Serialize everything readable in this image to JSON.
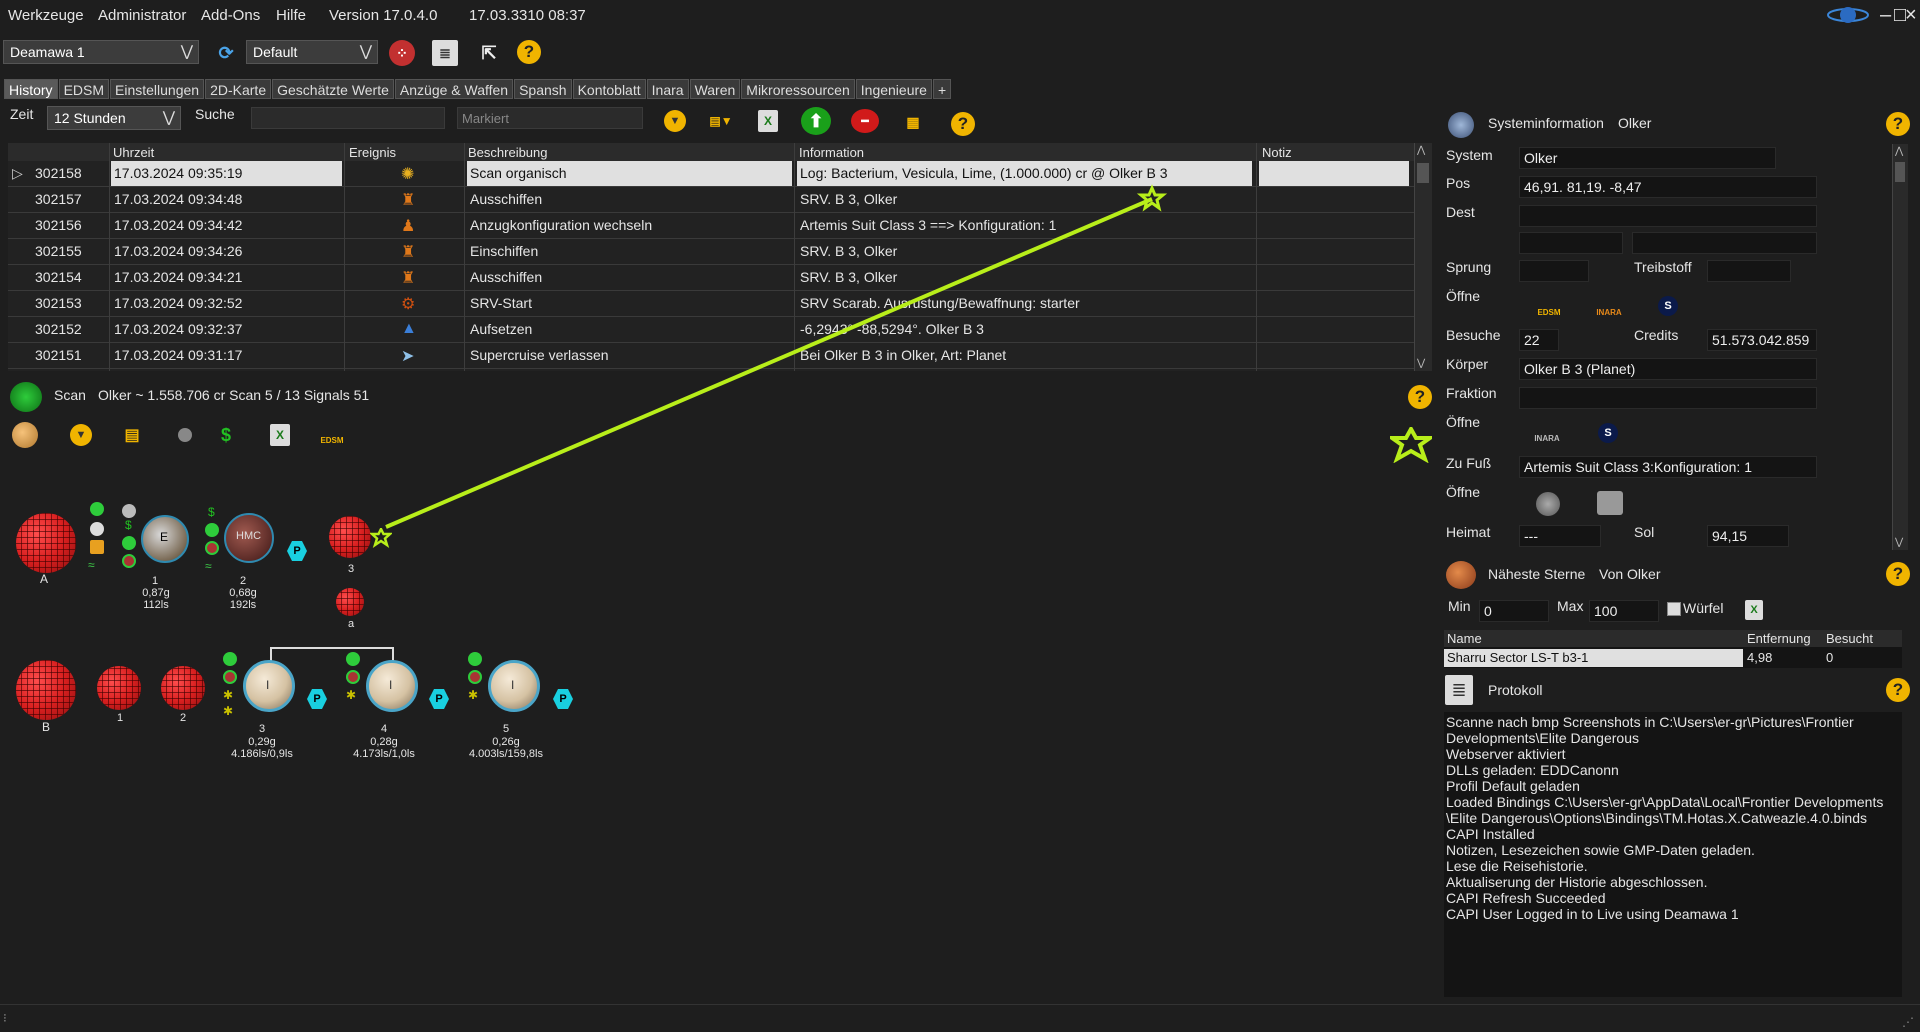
{
  "menu": {
    "items": [
      "Werkzeuge",
      "Administrator",
      "Add-Ons",
      "Hilfe"
    ],
    "version": "Version 17.0.4.0",
    "datetime": "17.03.3310 08:37"
  },
  "toolbar": {
    "commander": "Deamawa 1",
    "profile": "Default"
  },
  "tabs": [
    "History",
    "EDSM",
    "Einstellungen",
    "2D-Karte",
    "Geschätzte Werte",
    "Anzüge & Waffen",
    "Spansh",
    "Kontoblatt",
    "Inara",
    "Waren",
    "Mikroressourcen",
    "Ingenieure",
    "+"
  ],
  "filter": {
    "zeit_label": "Zeit",
    "zeit_value": "12 Stunden",
    "suche_label": "Suche",
    "suche_value": "",
    "markiert_placeholder": "Markiert"
  },
  "grid": {
    "columns": [
      "Uhrzeit",
      "Ereignis",
      "Beschreibung",
      "Information",
      "Notiz"
    ],
    "rows": [
      {
        "id": "302158",
        "time": "17.03.2024 09:35:19",
        "desc": "Scan organisch",
        "info": "Log: Bacterium, Vesicula, Lime, (1.000.000) cr @ Olker B 3",
        "note": ""
      },
      {
        "id": "302157",
        "time": "17.03.2024 09:34:48",
        "desc": "Ausschiffen",
        "info": "SRV. B 3, Olker",
        "note": ""
      },
      {
        "id": "302156",
        "time": "17.03.2024 09:34:42",
        "desc": "Anzugkonfiguration wechseln",
        "info": "Artemis Suit Class 3 ==> Konfiguration: 1",
        "note": ""
      },
      {
        "id": "302155",
        "time": "17.03.2024 09:34:26",
        "desc": "Einschiffen",
        "info": "SRV. B 3, Olker",
        "note": ""
      },
      {
        "id": "302154",
        "time": "17.03.2024 09:34:21",
        "desc": "Ausschiffen",
        "info": "SRV. B 3, Olker",
        "note": ""
      },
      {
        "id": "302153",
        "time": "17.03.2024 09:32:52",
        "desc": "SRV-Start",
        "info": "SRV Scarab. Ausrüstung/Bewaffnung: starter",
        "note": ""
      },
      {
        "id": "302152",
        "time": "17.03.2024 09:32:37",
        "desc": "Aufsetzen",
        "info": "-6,2943° -88,5294°. Olker B 3",
        "note": ""
      },
      {
        "id": "302151",
        "time": "17.03.2024 09:31:17",
        "desc": "Supercruise verlassen",
        "info": "Bei Olker B 3 in Olker, Art: Planet",
        "note": ""
      }
    ]
  },
  "scan": {
    "title": "Scan",
    "summary": "Olker ~ 1.558.706 cr Scan 5 / 13  Signals 51",
    "edsm_label": "EDSM",
    "bodies_a": [
      {
        "label": "A"
      },
      {
        "label": "1",
        "l2": "0,87g",
        "l3": "112ls",
        "inner": "E"
      },
      {
        "label": "2",
        "l2": "0,68g",
        "l3": "192ls",
        "inner": "HMC"
      },
      {
        "label": "3"
      },
      {
        "label": "a"
      }
    ],
    "bodies_b": [
      {
        "label": "B"
      },
      {
        "label": "1"
      },
      {
        "label": "2"
      },
      {
        "label": "3",
        "l2": "0,29g",
        "l3": "4.186ls/0,9ls",
        "inner": "I"
      },
      {
        "label": "4",
        "l2": "0,28g",
        "l3": "4.173ls/1,0ls",
        "inner": "I"
      },
      {
        "label": "5",
        "l2": "0,26g",
        "l3": "4.003ls/159,8ls",
        "inner": "I"
      }
    ],
    "p_badge": "P"
  },
  "sysinfo": {
    "title": "Systeminformation",
    "system_name": "Olker",
    "labels": {
      "system": "System",
      "pos": "Pos",
      "dest": "Dest",
      "sprung": "Sprung",
      "treibstoff": "Treibstoff",
      "oeffne": "Öffne",
      "besuche": "Besuche",
      "credits": "Credits",
      "koerper": "Körper",
      "fraktion": "Fraktion",
      "zufuss": "Zu Fuß",
      "heimat": "Heimat",
      "sol": "Sol"
    },
    "values": {
      "system": "Olker",
      "pos": "46,91. 81,19. -8,47",
      "dest": "",
      "sprung": "",
      "treibstoff": "",
      "besuche": "22",
      "credits": "51.573.042.859",
      "koerper": "Olker B 3 (Planet)",
      "fraktion": "",
      "zufuss": "Artemis Suit Class 3:Konfiguration: 1",
      "heimat": "---",
      "sol": "94,15"
    },
    "link_edsm": "EDSM",
    "link_inara": "INARA",
    "link_spansh": "S"
  },
  "nearest": {
    "title": "Näheste Sterne",
    "from": "Von Olker",
    "min_label": "Min",
    "min_value": "0",
    "max_label": "Max",
    "max_value": "100",
    "cube_label": "Würfel",
    "columns": [
      "Name",
      "Entfernung",
      "Besucht"
    ],
    "rows": [
      {
        "name": "Sharru Sector LS-T b3-1",
        "dist": "4,98",
        "visited": "0"
      }
    ]
  },
  "protokoll": {
    "title": "Protokoll",
    "lines": [
      "Scanne nach bmp Screenshots in C:\\Users\\er-gr\\Pictures\\Frontier",
      "Developments\\Elite Dangerous",
      "Webserver aktiviert",
      "DLLs geladen: EDDCanonn",
      "Profil Default geladen",
      "Loaded Bindings C:\\Users\\er-gr\\AppData\\Local\\Frontier Developments",
      "\\Elite Dangerous\\Options\\Bindings\\TM.Hotas.X.Catweazle.4.0.binds",
      "CAPI Installed",
      "Notizen, Lesezeichen sowie GMP-Daten geladen.",
      "Lese die Reisehistorie.",
      "Aktualiserung der Historie abgeschlossen.",
      "CAPI Refresh Succeeded",
      "CAPI User Logged in to Live using Deamawa 1"
    ]
  },
  "colors": {
    "accent_yellow": "#f0b400",
    "annotation_line": "#b8ee1a",
    "selection_bg": "#e0e0e0"
  }
}
